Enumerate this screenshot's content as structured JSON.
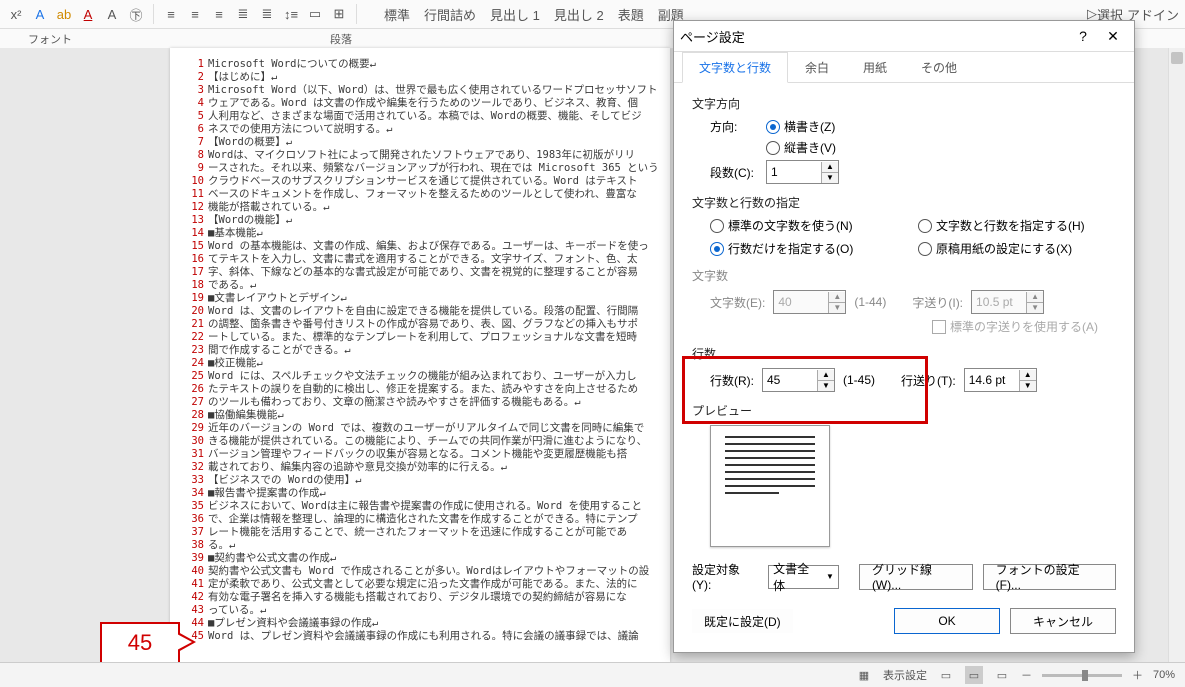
{
  "ribbon": {
    "font_label": "フォント",
    "para_label": "段落",
    "styles": [
      "標準",
      "行間詰め",
      "見出し 1",
      "見出し 2",
      "表題",
      "副題"
    ],
    "select_label": "選択",
    "addin_label": "アドイン"
  },
  "document": {
    "lines": [
      {
        "n": 1,
        "t": "Microsoft Wordについての概要↵"
      },
      {
        "n": 2,
        "t": "【はじめに】↵"
      },
      {
        "n": 3,
        "t": "Microsoft Word（以下、Word）は、世界で最も広く使用されているワードプロセッサソフト"
      },
      {
        "n": 4,
        "t": "ウェアである。Word は文書の作成や編集を行うためのツールであり、ビジネス、教育、個"
      },
      {
        "n": 5,
        "t": "人利用など、さまざまな場面で活用されている。本稿では、Wordの概要、機能、そしてビジ"
      },
      {
        "n": 6,
        "t": "ネスでの使用方法について説明する。↵"
      },
      {
        "n": 7,
        "t": "【Wordの概要】↵"
      },
      {
        "n": 8,
        "t": "Wordは、マイクロソフト社によって開発されたソフトウェアであり、1983年に初版がリリ"
      },
      {
        "n": 9,
        "t": "ースされた。それ以来、頻繁なバージョンアップが行われ、現在では Microsoft 365 という"
      },
      {
        "n": 10,
        "t": "クラウドベースのサブスクリプションサービスを通じて提供されている。Word はテキスト"
      },
      {
        "n": 11,
        "t": "ベースのドキュメントを作成し、フォーマットを整えるためのツールとして使われ、豊富な"
      },
      {
        "n": 12,
        "t": "機能が搭載されている。↵"
      },
      {
        "n": 13,
        "t": "【Wordの機能】↵"
      },
      {
        "n": 14,
        "t": "■基本機能↵"
      },
      {
        "n": 15,
        "t": "Word の基本機能は、文書の作成、編集、および保存である。ユーザーは、キーボードを使っ"
      },
      {
        "n": 16,
        "t": "てテキストを入力し、文書に書式を適用することができる。文字サイズ、フォント、色、太"
      },
      {
        "n": 17,
        "t": "字、斜体、下線などの基本的な書式設定が可能であり、文書を視覚的に整理することが容易"
      },
      {
        "n": 18,
        "t": "である。↵"
      },
      {
        "n": 19,
        "t": "■文書レイアウトとデザイン↵"
      },
      {
        "n": 20,
        "t": "Word は、文書のレイアウトを自由に設定できる機能を提供している。段落の配置、行間隔"
      },
      {
        "n": 21,
        "t": "の調整、箇条書きや番号付きリストの作成が容易であり、表、図、グラフなどの挿入もサポ"
      },
      {
        "n": 22,
        "t": "ートしている。また、標準的なテンプレートを利用して、プロフェッショナルな文書を短時"
      },
      {
        "n": 23,
        "t": "間で作成することができる。↵"
      },
      {
        "n": 24,
        "t": "■校正機能↵"
      },
      {
        "n": 25,
        "t": "Word には、スペルチェックや文法チェックの機能が組み込まれており、ユーザーが入力し"
      },
      {
        "n": 26,
        "t": "たテキストの誤りを自動的に検出し、修正を提案する。また、読みやすさを向上させるため"
      },
      {
        "n": 27,
        "t": "のツールも備わっており、文章の簡潔さや読みやすさを評価する機能もある。↵"
      },
      {
        "n": 28,
        "t": "■協働編集機能↵"
      },
      {
        "n": 29,
        "t": "近年のバージョンの Word では、複数のユーザーがリアルタイムで同じ文書を同時に編集で"
      },
      {
        "n": 30,
        "t": "きる機能が提供されている。この機能により、チームでの共同作業が円滑に進むようになり、"
      },
      {
        "n": 31,
        "t": "バージョン管理やフィードバックの収集が容易となる。コメント機能や変更履歴機能も搭"
      },
      {
        "n": 32,
        "t": "載されており、編集内容の追跡や意見交換が効率的に行える。↵"
      },
      {
        "n": 33,
        "t": "【ビジネスでの Wordの使用】↵"
      },
      {
        "n": 34,
        "t": "■報告書や提案書の作成↵"
      },
      {
        "n": 35,
        "t": "ビジネスにおいて、Wordは主に報告書や提案書の作成に使用される。Word を使用すること"
      },
      {
        "n": 36,
        "t": "で、企業は情報を整理し、論理的に構造化された文書を作成することができる。特にテンプ"
      },
      {
        "n": 37,
        "t": "レート機能を活用することで、統一されたフォーマットを迅速に作成することが可能であ"
      },
      {
        "n": 38,
        "t": "る。↵"
      },
      {
        "n": 39,
        "t": "■契約書や公式文書の作成↵"
      },
      {
        "n": 40,
        "t": "契約書や公式文書も Word で作成されることが多い。Wordはレイアウトやフォーマットの設"
      },
      {
        "n": 41,
        "t": "定が柔軟であり、公式文書として必要な規定に沿った文書作成が可能である。また、法的に"
      },
      {
        "n": 42,
        "t": "有効な電子署名を挿入する機能も搭載されており、デジタル環境での契約締結が容易にな"
      },
      {
        "n": 43,
        "t": "っている。↵"
      },
      {
        "n": 44,
        "t": "■プレゼン資料や会議議事録の作成↵"
      },
      {
        "n": 45,
        "t": "Word は、プレゼン資料や会議議事録の作成にも利用される。特に会議の議事録では、議論"
      }
    ]
  },
  "callout": {
    "value": "45"
  },
  "dialog": {
    "title": "ページ設定",
    "tabs": [
      "文字数と行数",
      "余白",
      "用紙",
      "その他"
    ],
    "active_tab": 0,
    "sec_dir": "文字方向",
    "dir_label": "方向:",
    "dir_h": "横書き(Z)",
    "dir_v": "縦書き(V)",
    "cols_label": "段数(C):",
    "cols_value": "1",
    "sec_spec": "文字数と行数の指定",
    "opt_std": "標準の文字数を使う(N)",
    "opt_both": "文字数と行数を指定する(H)",
    "opt_lines": "行数だけを指定する(O)",
    "opt_grid": "原稿用紙の設定にする(X)",
    "sec_chars": "文字数",
    "chars_label": "文字数(E):",
    "chars_value": "40",
    "chars_range": "(1-44)",
    "pitch_label": "字送り(I):",
    "pitch_value": "10.5 pt",
    "pitch_std_cb": "標準の字送りを使用する(A)",
    "sec_lines": "行数",
    "lines_label": "行数(R):",
    "lines_value": "45",
    "lines_range": "(1-45)",
    "lpitch_label": "行送り(T):",
    "lpitch_value": "14.6 pt",
    "sec_preview": "プレビュー",
    "apply_label": "設定対象(Y):",
    "apply_value": "文書全体",
    "btn_gridlines": "グリッド線(W)...",
    "btn_font": "フォントの設定(F)...",
    "btn_default": "既定に設定(D)",
    "btn_ok": "OK",
    "btn_cancel": "キャンセル"
  },
  "status": {
    "display": "表示設定",
    "zoom": "70%"
  }
}
